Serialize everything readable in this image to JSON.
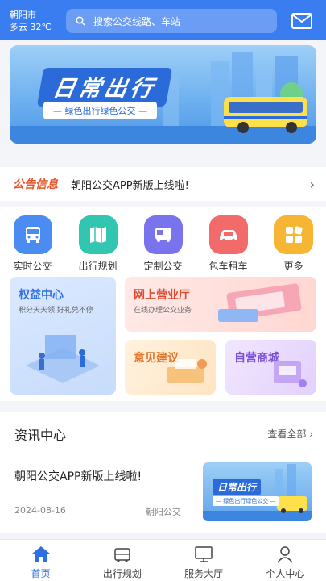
{
  "header": {
    "city": "朝阳市",
    "weather": "多云 32℃",
    "search_placeholder": "搜索公交线路、车站",
    "mail_icon": "mail-icon"
  },
  "banner": {
    "title": "日常出行",
    "slogan": "— 绿色出行绿色公交 —"
  },
  "notice": {
    "tag": "公告信息",
    "text": "朝阳公交APP新版上线啦!"
  },
  "quick_menu": [
    {
      "label": "实时公交",
      "icon": "bus-icon",
      "color": "#4a8cf2"
    },
    {
      "label": "出行规划",
      "icon": "map-icon",
      "color": "#32c6b1"
    },
    {
      "label": "定制公交",
      "icon": "custom-bus-icon",
      "color": "#7a73ee"
    },
    {
      "label": "包车租车",
      "icon": "car-icon",
      "color": "#f26a6a"
    },
    {
      "label": "更多",
      "icon": "more-icon",
      "color": "#f6b532"
    }
  ],
  "services": {
    "rights": {
      "title": "权益中心",
      "subtitle": "积分天天领 好礼兑不停"
    },
    "hall": {
      "title": "网上营业厅",
      "subtitle": "在线办理公交业务"
    },
    "feedback": {
      "title": "意见建议"
    },
    "mall": {
      "title": "自营商城"
    }
  },
  "news": {
    "title": "资讯中心",
    "more": "查看全部",
    "items": [
      {
        "title": "朝阳公交APP新版上线啦!",
        "date": "2024-08-16",
        "source": "朝阳公交",
        "thumb_title": "日常出行",
        "thumb_slogan": "— 绿色出行绿色公交 —"
      }
    ]
  },
  "tabbar": [
    {
      "label": "首页",
      "icon": "home-icon",
      "active": true
    },
    {
      "label": "出行规划",
      "icon": "route-icon",
      "active": false
    },
    {
      "label": "服务大厅",
      "icon": "monitor-icon",
      "active": false
    },
    {
      "label": "个人中心",
      "icon": "user-icon",
      "active": false
    }
  ],
  "colors": {
    "primary": "#3a7df0",
    "notice_tag": "#e6562c",
    "active_tab": "#2f6fe4"
  }
}
